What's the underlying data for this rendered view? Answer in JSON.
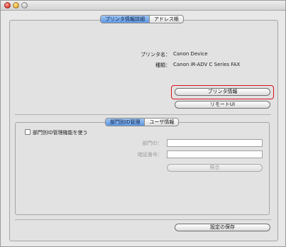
{
  "top_tabs": [
    {
      "label": "プリンタ情報詳細",
      "selected": true
    },
    {
      "label": "アドレス帳",
      "selected": false
    }
  ],
  "printer": {
    "name_label": "プリンタ名：",
    "name_value": "Canon Device",
    "type_label": "種類：",
    "type_value": "Canon iR-ADV C Series FAX"
  },
  "buttons": {
    "printer_info": "プリンタ情報",
    "remote_ui": "リモートUI",
    "verify": "照合",
    "save_settings": "設定の保存"
  },
  "dept_tabs": [
    {
      "label": "部門別ID管理",
      "selected": true
    },
    {
      "label": "ユーザ情報",
      "selected": false
    }
  ],
  "dept": {
    "use_checkbox_label": "部門別ID管理機能を使う",
    "use_checked": false,
    "dept_id_label": "部門ID：",
    "dept_id_value": "",
    "pin_label": "暗証番号：",
    "pin_value": ""
  },
  "colors": {
    "highlight": "#d9121b",
    "tab_selected": "#5f98e0"
  }
}
